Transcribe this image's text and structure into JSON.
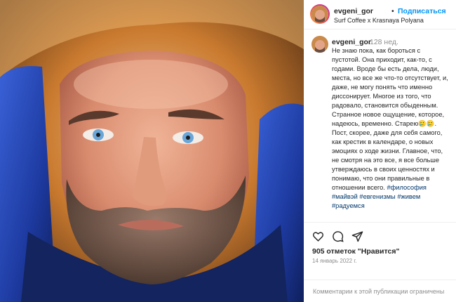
{
  "post": {
    "username": "evgeni_gor",
    "follow_label": "Подписаться",
    "separator": "•",
    "location": "Surf Coffee x Krasnaya Polyana",
    "caption_username": "evgeni_gor",
    "caption_time": "128 нед.",
    "caption_lines": [
      "Не знаю пока, как бороться с",
      "пустотой. Она приходит, как-то, с",
      "годами. Вроде бы есть дела, люди,",
      "места, но все же что-то отсутствует, и,",
      "даже, не могу понять что именно",
      "диссонирует. Многое из того, что",
      "радовало, становится обыденным.",
      "Странное новое ощущение, которое,",
      "надеюсь, временно. Старею🥲🥲.",
      "Пост, скорее, даже для себя самого,",
      "как крестик в календаре, о новых",
      "эмоциях о ходе жизни. Главное, что,",
      "не смотря на это все, я все больше",
      "утверждаюсь в своих ценностях и",
      "понимаю, что они правильные в",
      "отношении всего."
    ],
    "hashtags": [
      "#философия",
      "#майвэй",
      "#евгенизмы",
      "#живем",
      "#радуемся"
    ],
    "likes": "905 отметок \"Нравится\"",
    "date": "14 январь 2022 г.",
    "comment_placeholder": "Комментарии к этой публикации ограничены"
  },
  "icons": {
    "like": "heart-icon",
    "comment": "comment-bubble-icon",
    "share": "paper-plane-icon"
  },
  "colors": {
    "follow": "#0095f6",
    "hashtag": "#00376b",
    "muted": "#8e8e8e",
    "text": "#262626"
  }
}
